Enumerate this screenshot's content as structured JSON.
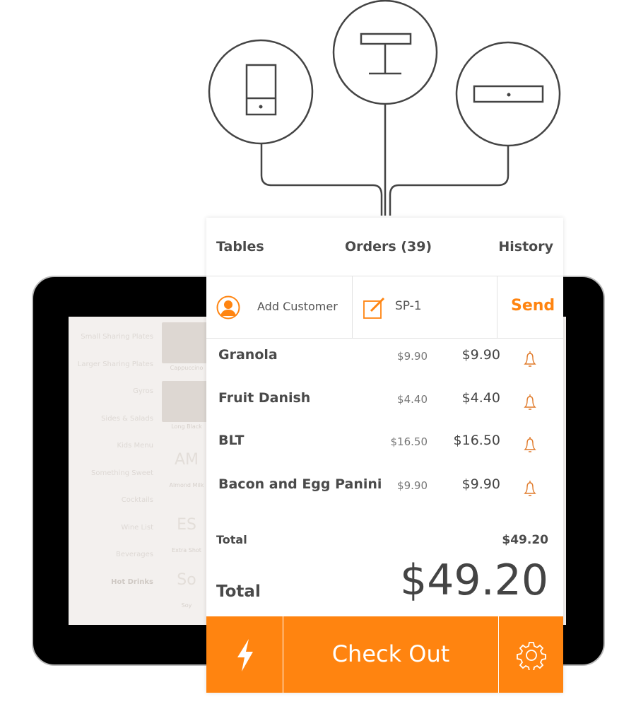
{
  "tabs": [
    {
      "label": "Tables"
    },
    {
      "label": "Orders (39)"
    },
    {
      "label": "History"
    }
  ],
  "action_row": {
    "add_customer": "Add Customer",
    "order_name": "SP-1",
    "send": "Send"
  },
  "items": [
    {
      "name": "Granola",
      "unit_price": "$9.90",
      "total": "$9.90"
    },
    {
      "name": "Fruit Danish",
      "unit_price": "$4.40",
      "total": "$4.40"
    },
    {
      "name": "BLT",
      "unit_price": "$16.50",
      "total": "$16.50"
    },
    {
      "name": "Bacon and Egg Panini",
      "unit_price": "$9.90",
      "total": "$9.90"
    }
  ],
  "subtotal": {
    "label": "Total",
    "value": "$49.20"
  },
  "total": {
    "label": "Total",
    "value": "$49.20"
  },
  "footer": {
    "checkout": "Check Out",
    "left_icon": "lightning-icon",
    "right_icon": "gear-icon"
  },
  "background_menu": [
    "Small Sharing Plates",
    "Larger Sharing Plates",
    "Gyros",
    "Sides & Salads",
    "Kids Menu",
    "Something Sweet",
    "Cocktails",
    "Wine List",
    "Beverages",
    "Hot Drinks"
  ],
  "background_tiles": [
    {
      "abbr": "",
      "label": "Cappuccino"
    },
    {
      "abbr": "",
      "label": "Long Black"
    },
    {
      "abbr": "AM",
      "label": "Almond Milk"
    },
    {
      "abbr": "ES",
      "label": "Extra Shot"
    },
    {
      "abbr": "So",
      "label": "Soy"
    }
  ],
  "colors": {
    "accent": "#ff8410",
    "text": "#4a4a4a",
    "line": "#444444"
  }
}
